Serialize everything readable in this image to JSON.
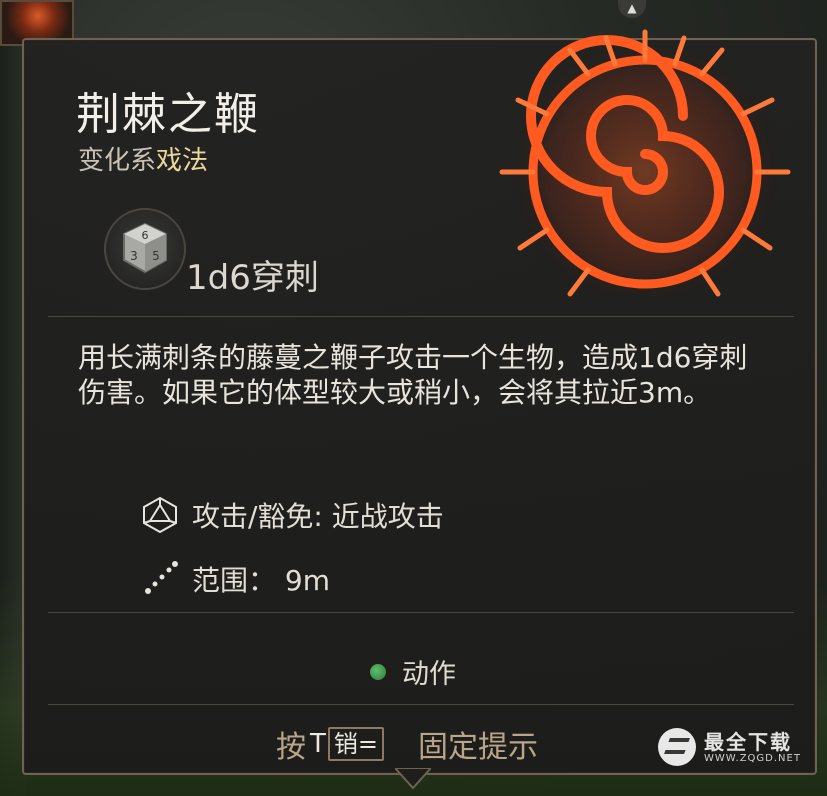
{
  "spell": {
    "title": "荆棘之鞭",
    "school": "变化系",
    "type": "戏法",
    "damage": "1d6穿刺",
    "description": "用长满刺条的藤蔓之鞭子攻击一个生物，造成1d6穿刺伤害。如果它的体型较大或稍小，会将其拉近3m。",
    "attack_save": "攻击/豁免: 近战攻击",
    "range": "范围：  9m",
    "action": "动作"
  },
  "hint": {
    "press": "按",
    "key": "T",
    "key_glyph": "销=",
    "label": "固定提示"
  },
  "watermark": {
    "name": "最全下载",
    "url": "WWW.ZQGD.NET"
  },
  "icons": {
    "spell_art": "thorn-whip-spiral-icon",
    "dice": "d6-dice-icon",
    "attack": "d20-icon",
    "range": "range-dotted-line-icon",
    "action": "action-green-dot-icon"
  },
  "colors": {
    "panel_border": "#6d6253",
    "accent_gold": "#e9d79a",
    "fire_orange": "#ff5a1f",
    "action_green": "#4caf50"
  }
}
